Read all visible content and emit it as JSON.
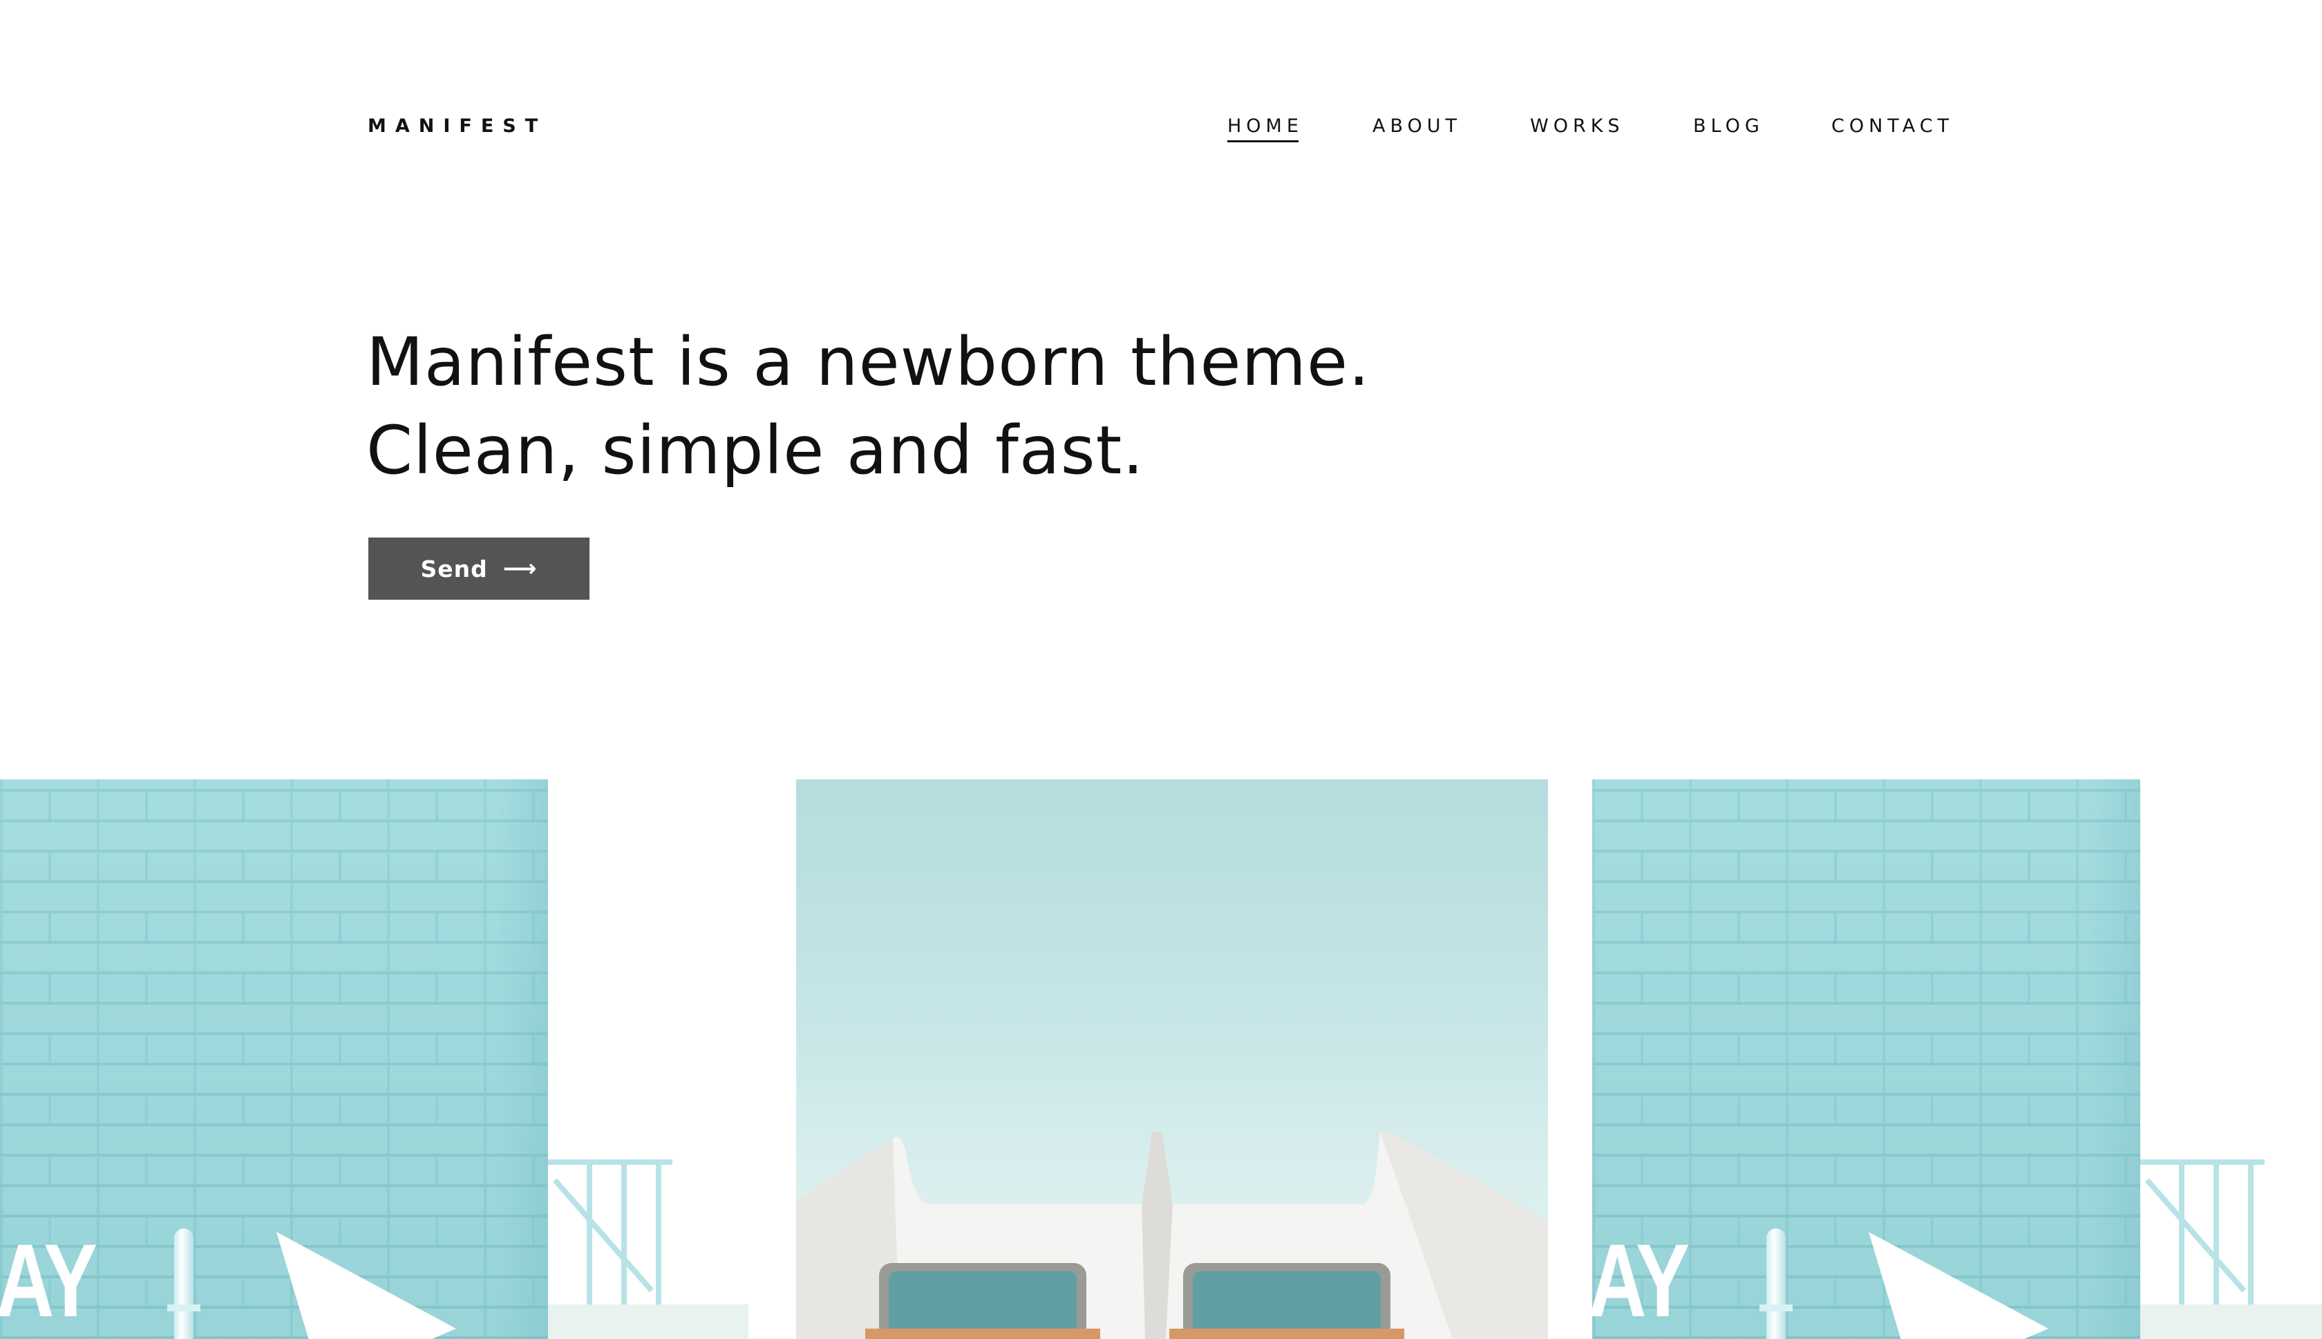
{
  "brand": {
    "logo_text": "MANIFEST"
  },
  "nav": {
    "items": [
      {
        "label": "HOME",
        "active": true
      },
      {
        "label": "ABOUT",
        "active": false
      },
      {
        "label": "WORKS",
        "active": false
      },
      {
        "label": "BLOG",
        "active": false
      },
      {
        "label": "CONTACT",
        "active": false
      }
    ]
  },
  "hero": {
    "line1": "Manifest is a newborn theme.",
    "line2": "Clean, simple and fast.",
    "button_label": "Send",
    "button_icon": "arrow-right-icon",
    "button_color": "#545454"
  },
  "gallery": {
    "cards": [
      {
        "subject": "turquoise brick wall",
        "wall_text": "AY"
      },
      {
        "subject": "white building against sky"
      },
      {
        "subject": "turquoise brick wall",
        "wall_text": "AY"
      }
    ],
    "colors": {
      "wall": "#9bd8dc",
      "sky": "#b5dcde"
    }
  }
}
